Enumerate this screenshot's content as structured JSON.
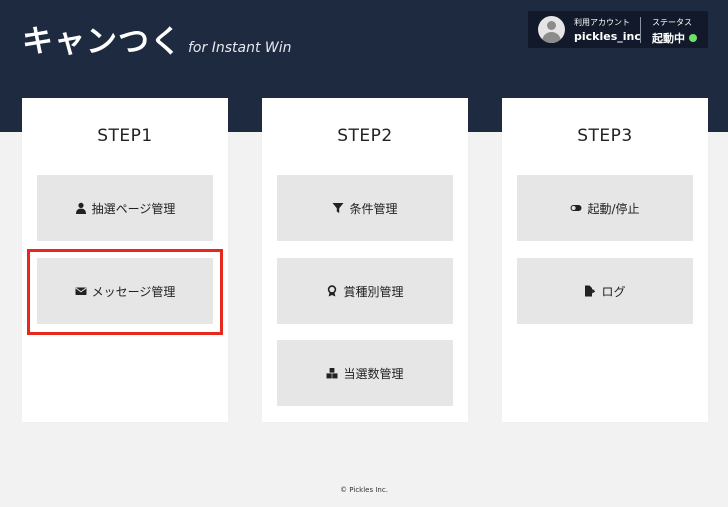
{
  "header": {
    "logo_main": "キャンつく",
    "logo_sub": "for Instant Win",
    "account": {
      "label": "利用アカウント",
      "name": "pickles_inc"
    },
    "status": {
      "label": "ステータス",
      "value": "起動中",
      "indicator_color": "#6fe06b"
    }
  },
  "cards": [
    {
      "title": "STEP1",
      "buttons": [
        {
          "label": "抽選ページ管理",
          "icon": "user-icon"
        },
        {
          "label": "メッセージ管理",
          "icon": "envelope-icon",
          "highlighted": true
        }
      ]
    },
    {
      "title": "STEP2",
      "buttons": [
        {
          "label": "条件管理",
          "icon": "filter-icon"
        },
        {
          "label": "賞種別管理",
          "icon": "award-icon"
        },
        {
          "label": "当選数管理",
          "icon": "boxes-icon"
        }
      ]
    },
    {
      "title": "STEP3",
      "buttons": [
        {
          "label": "起動/停止",
          "icon": "toggle-icon"
        },
        {
          "label": "ログ",
          "icon": "file-export-icon"
        }
      ]
    }
  ],
  "footer": {
    "copyright": "© Pickles Inc."
  },
  "colors": {
    "header_bg": "#1e2a40",
    "highlight_border": "#e8281c"
  }
}
